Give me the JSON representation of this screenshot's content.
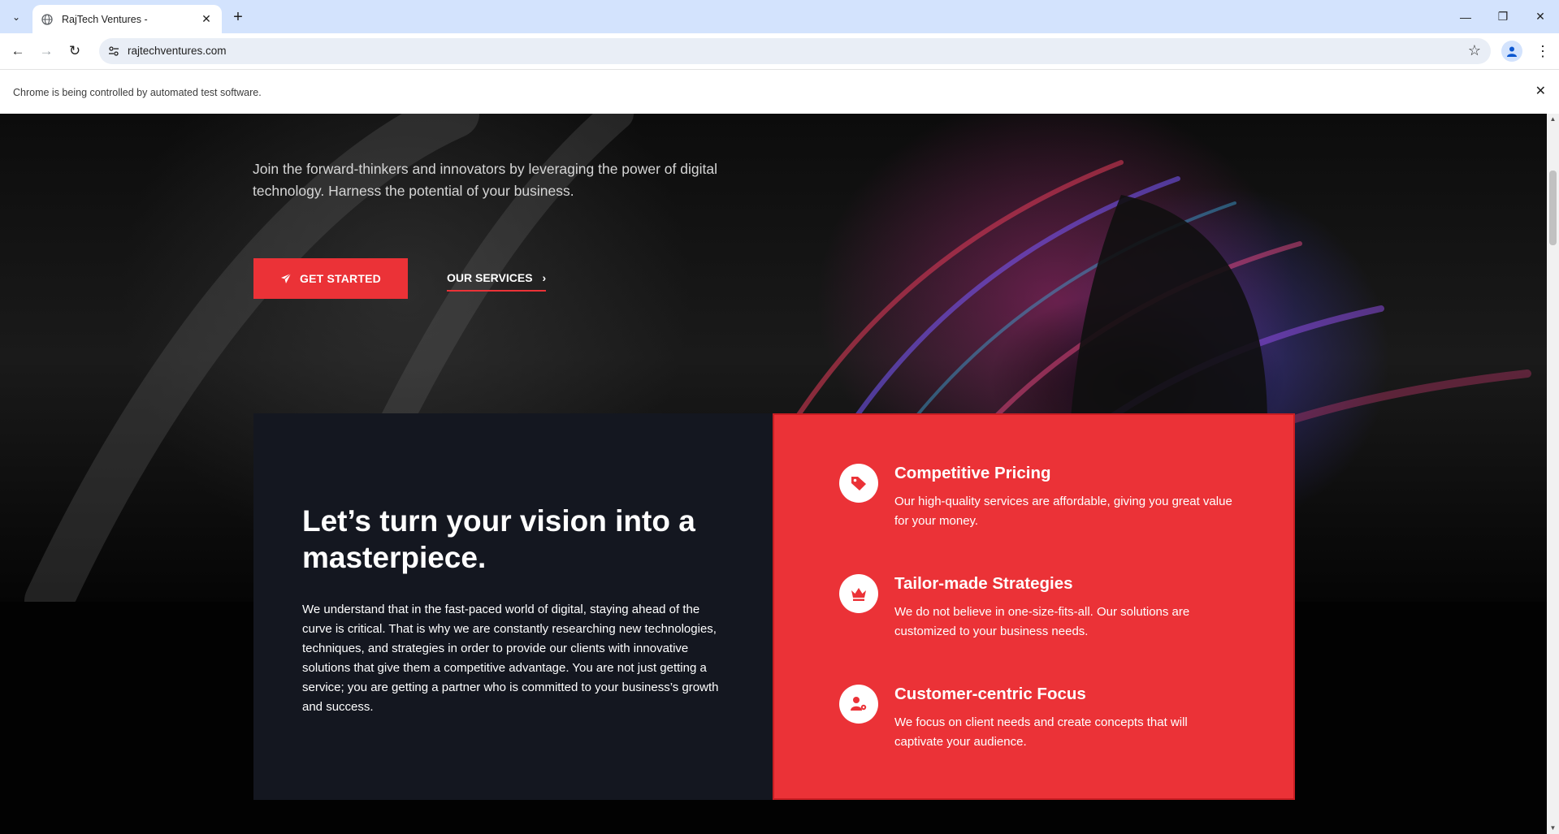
{
  "browser": {
    "tab_title": "RajTech Ventures -",
    "url": "rajtechventures.com",
    "infobar_message": "Chrome is being controlled by automated test software."
  },
  "hero": {
    "tagline": "Join the forward-thinkers and innovators by leveraging the power of digital technology. Harness the potential of your business.",
    "primary_button": "GET STARTED",
    "secondary_button": "OUR SERVICES"
  },
  "intro": {
    "heading": "Let’s turn your vision into a masterpiece.",
    "body": "We understand that in the fast-paced world of digital, staying ahead of the curve is critical. That is why we are constantly researching new technologies, techniques, and strategies in order to provide our clients with innovative solutions that give them a competitive advantage. You are not just getting a service; you are getting a partner who is committed to your business’s growth and success."
  },
  "features": [
    {
      "icon": "price-tag-icon",
      "title": "Competitive Pricing",
      "description": "Our high-quality services are affordable, giving you great value for your money."
    },
    {
      "icon": "crown-icon",
      "title": "Tailor-made Strategies",
      "description": "We do not believe in one-size-fits-all. Our solutions are customized to your business needs."
    },
    {
      "icon": "user-gear-icon",
      "title": "Customer-centric Focus",
      "description": "We focus on client needs and create concepts that will captivate your audience."
    }
  ],
  "colors": {
    "accent": "#eb3237",
    "panel_dark": "#141720",
    "chrome_tabbar": "#d3e3fd"
  }
}
